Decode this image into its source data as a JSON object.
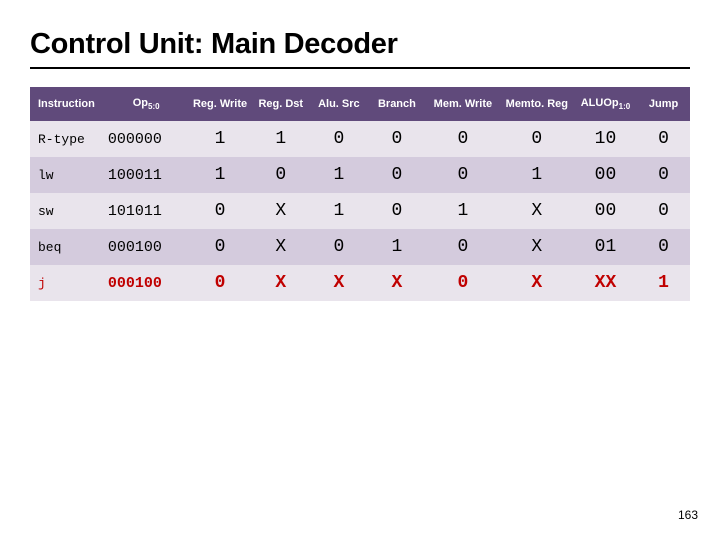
{
  "title": "Control Unit: Main Decoder",
  "page_number": "163",
  "headers": {
    "instruction": "Instruction",
    "op_pre": "Op",
    "op_sub": "5:0",
    "regwrite": "Reg. Write",
    "regdst": "Reg. Dst",
    "alusrc": "Alu. Src",
    "branch": "Branch",
    "memwrite": "Mem. Write",
    "memtoreg": "Memto. Reg",
    "aluop_pre": "ALUOp",
    "aluop_sub": "1:0",
    "jump": "Jump"
  },
  "chart_data": {
    "type": "table",
    "title": "Control Unit: Main Decoder",
    "columns": [
      "Instruction",
      "Op5:0",
      "Reg.Write",
      "Reg.Dst",
      "Alu.Src",
      "Branch",
      "Mem.Write",
      "Memto.Reg",
      "ALUOp1:0",
      "Jump"
    ],
    "rows": [
      {
        "instruction": "R-type",
        "op": "000000",
        "regwrite": "1",
        "regdst": "1",
        "alusrc": "0",
        "branch": "0",
        "memwrite": "0",
        "memtoreg": "0",
        "aluop": "10",
        "jump": "0",
        "highlight": false
      },
      {
        "instruction": "lw",
        "op": "100011",
        "regwrite": "1",
        "regdst": "0",
        "alusrc": "1",
        "branch": "0",
        "memwrite": "0",
        "memtoreg": "1",
        "aluop": "00",
        "jump": "0",
        "highlight": false
      },
      {
        "instruction": "sw",
        "op": "101011",
        "regwrite": "0",
        "regdst": "X",
        "alusrc": "1",
        "branch": "0",
        "memwrite": "1",
        "memtoreg": "X",
        "aluop": "00",
        "jump": "0",
        "highlight": false
      },
      {
        "instruction": "beq",
        "op": "000100",
        "regwrite": "0",
        "regdst": "X",
        "alusrc": "0",
        "branch": "1",
        "memwrite": "0",
        "memtoreg": "X",
        "aluop": "01",
        "jump": "0",
        "highlight": false
      },
      {
        "instruction": "j",
        "op": "000100",
        "regwrite": "0",
        "regdst": "X",
        "alusrc": "X",
        "branch": "X",
        "memwrite": "0",
        "memtoreg": "X",
        "aluop": "XX",
        "jump": "1",
        "highlight": true
      }
    ]
  }
}
